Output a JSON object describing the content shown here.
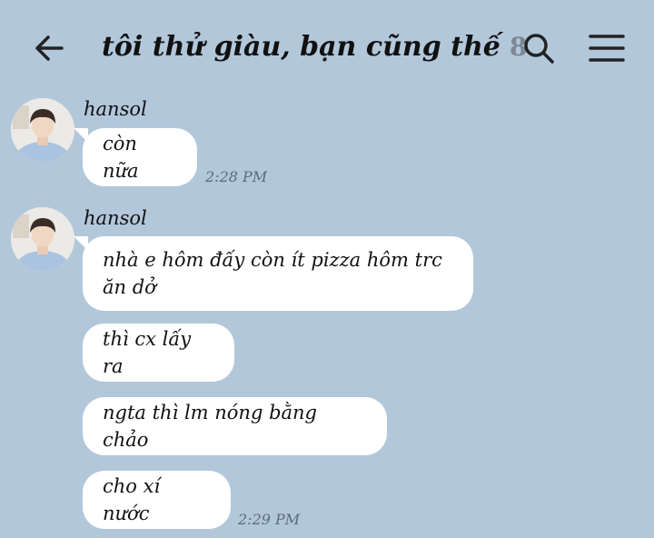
{
  "header": {
    "title": "tôi thử giàu, bạn cũng thế",
    "member_count": "8",
    "icons": [
      "back-arrow-icon",
      "search-icon",
      "menu-icon"
    ]
  },
  "messages": [
    {
      "sender": "hansol",
      "bubbles": [
        "còn nữa"
      ],
      "time": "2:28 PM"
    },
    {
      "sender": "hansol",
      "bubbles": [
        "nhà e hôm đấy còn ít pizza hôm trc ăn dở",
        "thì cx lấy ra",
        "ngta thì lm nóng bằng chảo",
        "cho xí nước"
      ],
      "time": "2:29 PM"
    }
  ],
  "colors": {
    "background": "#b2c7da",
    "bubble": "#ffffff",
    "time": "#5b6b7a"
  }
}
